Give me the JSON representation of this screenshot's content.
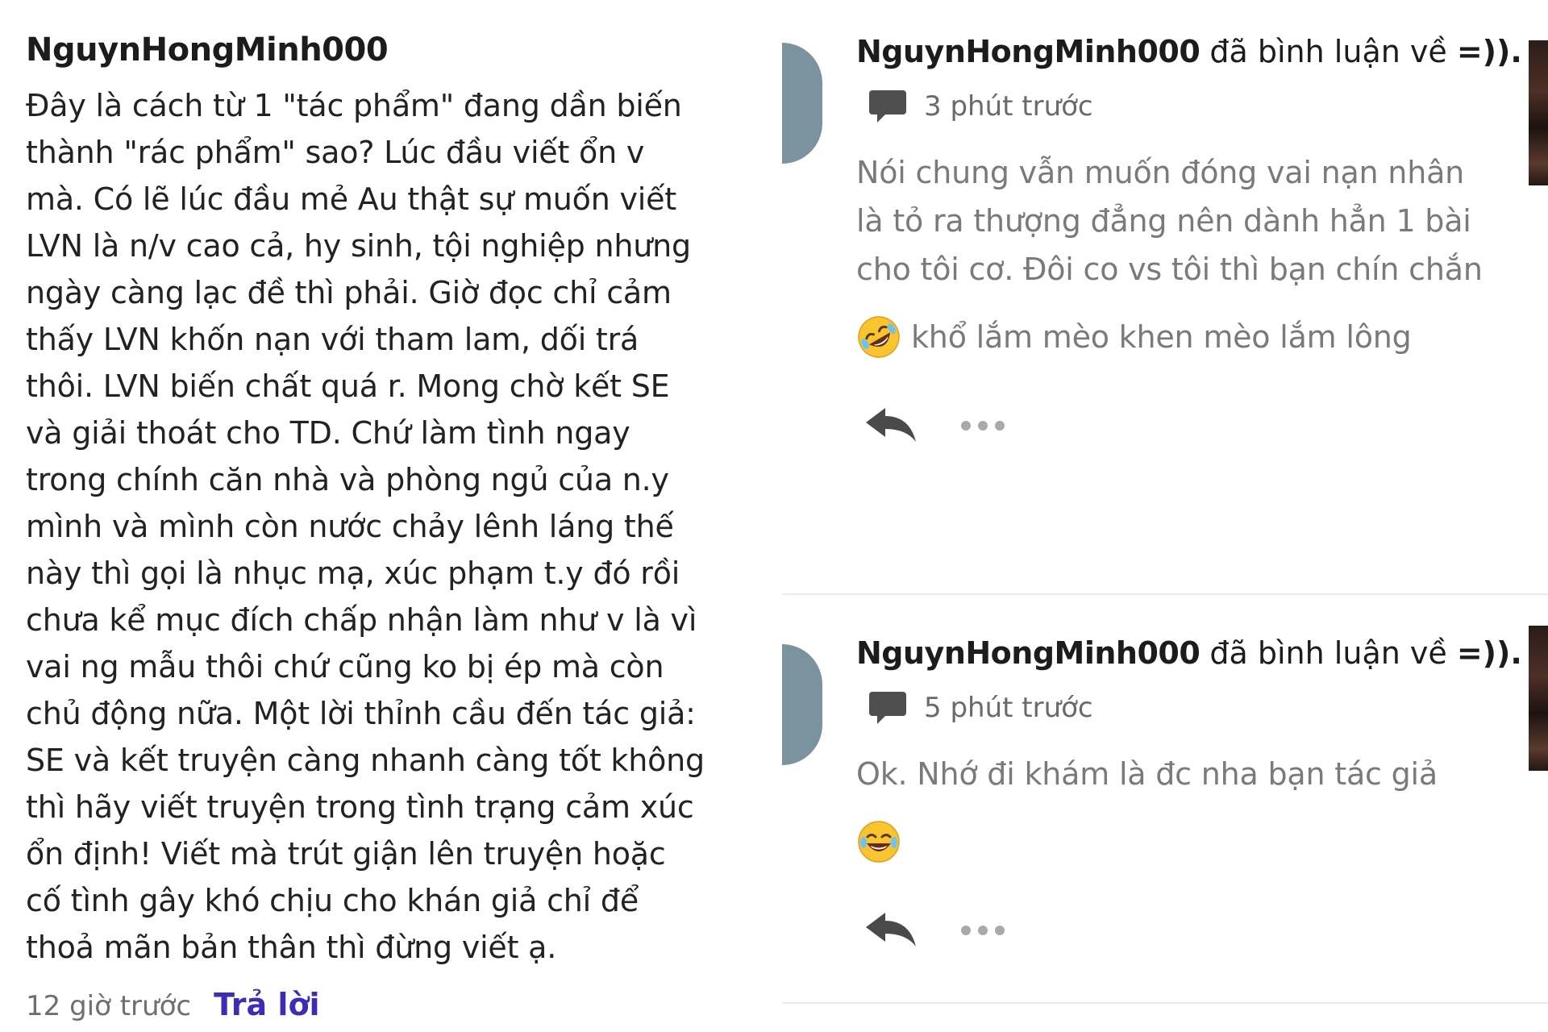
{
  "comment": {
    "username": "NguynHongMinh000",
    "lines": [
      "Đây là cách từ 1 \"tác phẩm\" đang dần biến",
      "thành \"rác phẩm\" sao? Lúc đầu viết ổn v",
      "mà. Có lẽ lúc đầu mẻ Au thật sự muốn viết",
      "LVN là n/v cao cả, hy sinh, tội nghiệp nhưng",
      "ngày càng lạc đề thì phải. Giờ đọc chỉ cảm",
      "thấy LVN khốn nạn với tham lam, dối trá",
      "thôi. LVN biến chất quá r. Mong chờ kết SE",
      "và giải thoát cho TD. Chứ làm tình ngay",
      "trong chính căn nhà và phòng ngủ của n.y",
      "mình và mình còn nước chảy lênh láng thế",
      "này thì gọi là nhục mạ, xúc phạm t.y đó rồi",
      "chưa kể mục đích chấp nhận làm như v là vì",
      "vai ng mẫu thôi chứ cũng ko bị ép mà còn",
      "chủ động nữa. Một lời thỉnh cầu đến tác giả:",
      "SE và kết truyện càng nhanh càng tốt không",
      "thì hãy viết truyện trong tình trạng cảm xúc",
      "ổn định! Viết mà trút giận lên truyện hoặc",
      "cố tình gây khó chịu cho khán giả chỉ để",
      "thoả mãn bản thân thì đừng viết ạ."
    ],
    "time": "12 giờ trước",
    "reply_label": "Trả lời"
  },
  "notifications": [
    {
      "username": "NguynHongMinh000",
      "action": " đã bình luận về ",
      "story": "=)).",
      "time": "3 phút trước",
      "body_lines": [
        "Nói chung vẫn muốn đóng vai nạn nhân",
        "là tỏ ra thượng đẳng nên dành hẳn 1 bài",
        "cho tôi cơ. Đôi co vs tôi thì bạn chín chắn"
      ],
      "emoji": "rolling-on-floor-laughing",
      "emoji_text": " khổ lắm mèo khen mèo lắm lông"
    },
    {
      "username": "NguynHongMinh000",
      "action": " đã bình luận về ",
      "story": "=)).",
      "time": "5 phút trước",
      "body_lines": [
        "Ok. Nhớ đi khám là đc nha bạn tác giả"
      ],
      "emoji": "face-with-tears-of-joy",
      "emoji_text": ""
    }
  ],
  "colors": {
    "reply_link": "#3c2db4",
    "avatar": "#7b929f",
    "muted_text": "#7a7a7a"
  }
}
